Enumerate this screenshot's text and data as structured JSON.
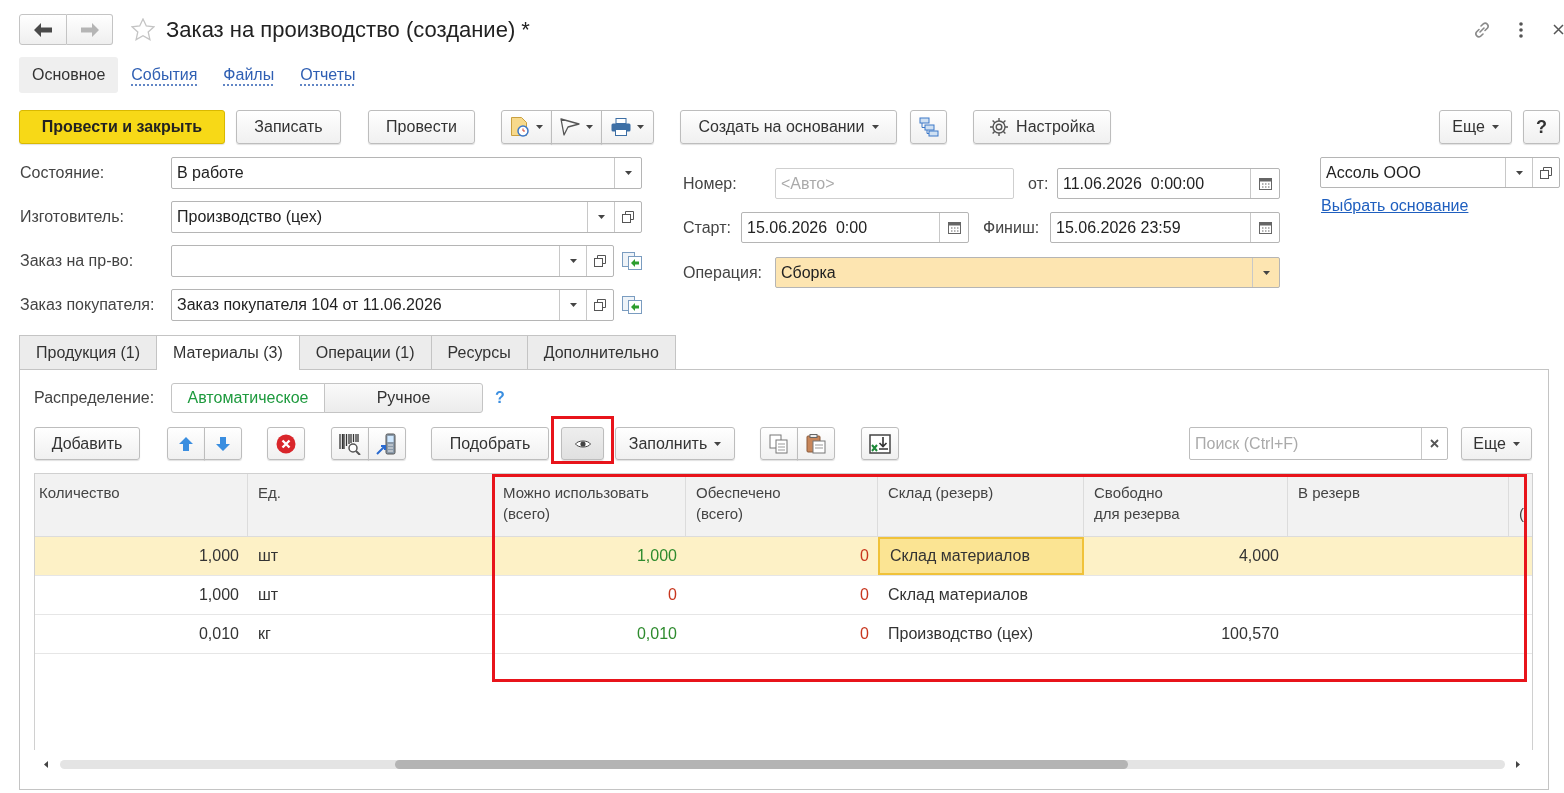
{
  "window": {
    "title": "Заказ на производство (создание) *"
  },
  "nav": [
    {
      "label": "Основное",
      "selected": true
    },
    {
      "label": "События",
      "selected": false
    },
    {
      "label": "Файлы",
      "selected": false
    },
    {
      "label": "Отчеты",
      "selected": false
    }
  ],
  "command_bar": {
    "post_and_close": "Провести и закрыть",
    "save": "Записать",
    "post": "Провести",
    "create_based_on": "Создать на основании",
    "settings": "Настройка",
    "more": "Еще",
    "help": "?"
  },
  "header_left": [
    {
      "kind": "select",
      "label": "Состояние:",
      "value": "В работе"
    },
    {
      "kind": "reference",
      "label": "Изготовитель:",
      "value": "Производство (цех)"
    },
    {
      "kind": "reference-pick",
      "label": "Заказ на пр-во:"
    },
    {
      "kind": "reference-pick",
      "label": "Заказ покупателя:",
      "value": "Заказ покупателя 104 от 11.06.2026"
    }
  ],
  "number": {
    "label": "Номер:",
    "placeholder": "<Авто>"
  },
  "date": {
    "label": "от:",
    "value": "11.06.2026  0:00:00"
  },
  "start": {
    "label": "Старт:",
    "value": "15.06.2026  0:00"
  },
  "finish": {
    "label": "Финиш:",
    "value": "15.06.2026 23:59"
  },
  "operation": {
    "label": "Операция:",
    "value": "Сборка",
    "highlighted": true
  },
  "organization": {
    "value": "Ассоль ООО",
    "link": "Выбрать основание"
  },
  "tabs": [
    {
      "label": "Продукция (1)",
      "selected": false
    },
    {
      "label": "Материалы (3)",
      "selected": true
    },
    {
      "label": "Операции (1)",
      "selected": false
    },
    {
      "label": "Ресурсы",
      "selected": false
    },
    {
      "label": "Дополнительно",
      "selected": false
    }
  ],
  "distribution": {
    "label": "Распределение:",
    "options": [
      {
        "label": "Автоматическое",
        "selected": true
      },
      {
        "label": "Ручное",
        "selected": false
      }
    ],
    "help": "?"
  },
  "table_toolbar": {
    "add": "Добавить",
    "pick": "Подобрать",
    "view_button": {
      "highlighted": true
    },
    "fill": "Заполнить",
    "search": {
      "placeholder": "Поиск (Ctrl+F)"
    },
    "more": "Еще"
  },
  "table": {
    "highlighted": true,
    "columns": [
      {
        "label": "Количество",
        "kind": "number"
      },
      {
        "label": "Ед.",
        "kind": "text"
      },
      {
        "label": "Можно использовать\n(всего)",
        "kind": "number"
      },
      {
        "label": "Обеспечено\n(всего)",
        "kind": "number"
      },
      {
        "label": "Склад (резерв)",
        "kind": "text"
      },
      {
        "label": "Свободно\nдля резерва",
        "kind": "number"
      },
      {
        "label": "В резерв"
      },
      {
        "label": "\n("
      }
    ],
    "rows": [
      {
        "selected": true,
        "cells": [
          {
            "text": "1,000"
          },
          {
            "text": "шт"
          },
          {
            "text": "1,000",
            "color": "#2e8b2e"
          },
          {
            "text": "0",
            "color": "#c8361e"
          },
          {
            "text": "Склад материалов",
            "focused": true
          },
          {
            "text": "4,000"
          }
        ]
      },
      {
        "selected": false,
        "cells": [
          {
            "text": "1,000"
          },
          {
            "text": "шт"
          },
          {
            "text": "0",
            "color": "#c8361e"
          },
          {
            "text": "0",
            "color": "#c8361e"
          },
          {
            "text": "Склад материалов"
          }
        ]
      },
      {
        "selected": false,
        "cells": [
          {
            "text": "0,010"
          },
          {
            "text": "кг"
          },
          {
            "text": "0,010",
            "color": "#2e8b2e"
          },
          {
            "text": "0",
            "color": "#c8361e"
          },
          {
            "text": "Производство (цех)"
          },
          {
            "text": "100,570"
          }
        ]
      }
    ]
  }
}
